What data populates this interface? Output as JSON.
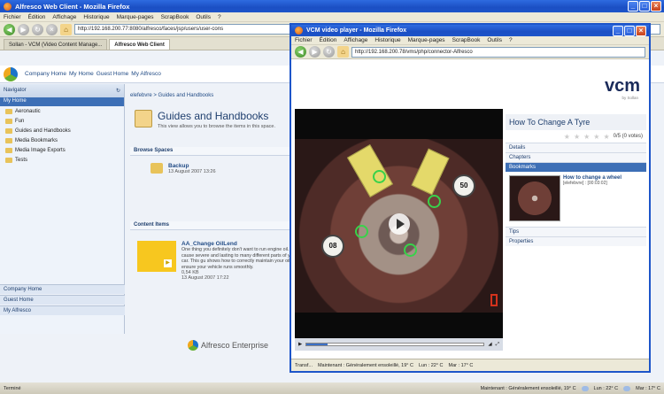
{
  "main_window": {
    "title": "Alfresco Web Client - Mozilla Firefox",
    "menu": [
      "Fichier",
      "Édition",
      "Affichage",
      "Historique",
      "Marque-pages",
      "ScrapBook",
      "Outils",
      "?"
    ],
    "url": "http://192.168.200.77:8080/alfresco/faces/jsp/users/user-cons",
    "tabs": [
      "Sollan - VCM (Video Content Manage...",
      "Alfresco Web Client"
    ]
  },
  "alfresco": {
    "header_links": [
      "Company Home",
      "My Home",
      "Guest Home",
      "My Alfresco"
    ],
    "navigator_label": "Navigator",
    "my_home": "My Home",
    "tree": [
      "Aeronautic",
      "Fun",
      "Guides and Handbooks",
      "Media Bookmarks",
      "Media Image Exports",
      "Tests"
    ],
    "nav_bottom": [
      "Company Home",
      "Guest Home",
      "My Alfresco"
    ],
    "breadcrumb": "elefebvre > Guides and Handbooks",
    "page_title": "Guides and Handbooks",
    "page_desc": "This view allows you to browse the items in this space.",
    "browse_spaces": "Browse Spaces",
    "space_name": "Backup",
    "space_date": "13 August 2007 13:26",
    "content_items": "Content Items",
    "item_name": "AA_Change OilLend",
    "item_text": "One thing you definitely don't want to run engine oil. It can cause severe and lasting to many different parts of your car. This gu shows how to correctly maintain your oil lev ensure your vehicle runs smoothly.",
    "item_size": "0,54 KB",
    "item_date": "13 August 2007 17:22",
    "footer": "Alfresco Enterprise"
  },
  "video_window": {
    "title": "VCM video player - Mozilla Firefox",
    "menu": [
      "Fichier",
      "Édition",
      "Affichage",
      "Historique",
      "Marque-pages",
      "ScrapBook",
      "Outils",
      "?"
    ],
    "url": "http://192.168.200.78/vms/php/connector-Alfresco",
    "logo": "vcm",
    "logo_sub": "by Sollan",
    "video_title": "How To Change A Tyre",
    "rating": "0/5 (0 votes)",
    "sections": [
      "Details",
      "Chapters",
      "Bookmarks",
      "Tips",
      "Properties"
    ],
    "bookmark_title": "How to change a wheel",
    "bookmark_sub": "[elefebvre] : [00:03:02]",
    "dial_numbers": [
      "50",
      "08"
    ],
    "status": "Transf...",
    "weather": "Maintenant : Généralement ensoleillé, 19° C",
    "weather_mon": "Lun : 22° C",
    "weather_tue": "Mar : 17° C"
  },
  "taskbar": {
    "label": "Terminé",
    "weather": "Maintenant : Généralement ensoleillé, 19° C",
    "mon": "Lun : 22° C",
    "tue": "Mar : 17° C"
  },
  "colors": {
    "xp_blue": "#1b4fc4",
    "alfresco_blue": "#3d6fb6",
    "play_green": "#38d24a"
  },
  "video_progress": 0.12
}
